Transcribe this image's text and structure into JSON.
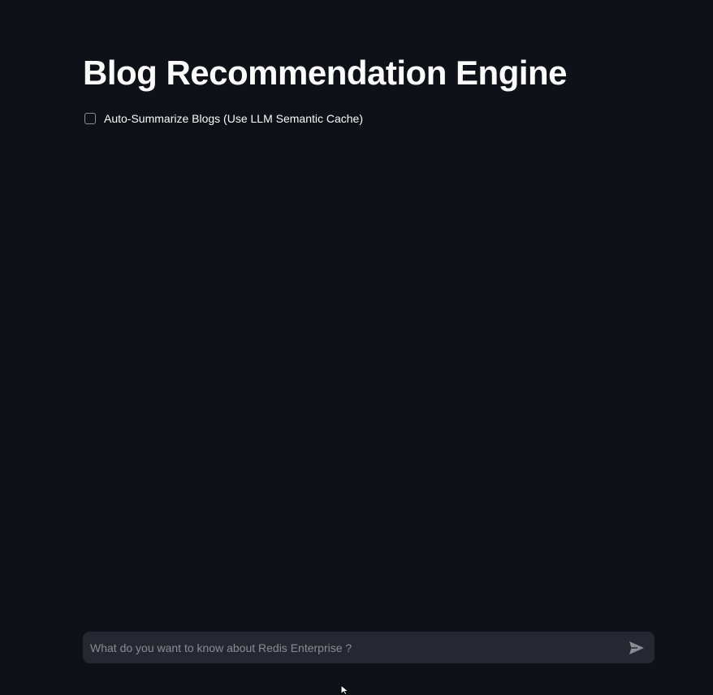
{
  "header": {
    "title": "Blog Recommendation Engine"
  },
  "options": {
    "auto_summarize_label": "Auto-Summarize Blogs (Use LLM Semantic Cache)",
    "auto_summarize_checked": false
  },
  "chat": {
    "placeholder": "What do you want to know about Redis Enterprise ?",
    "value": "",
    "send_icon": "send-icon"
  },
  "colors": {
    "background": "#0e1117",
    "input_background": "#262730",
    "text": "#fafafa",
    "placeholder": "#8a8c93"
  }
}
